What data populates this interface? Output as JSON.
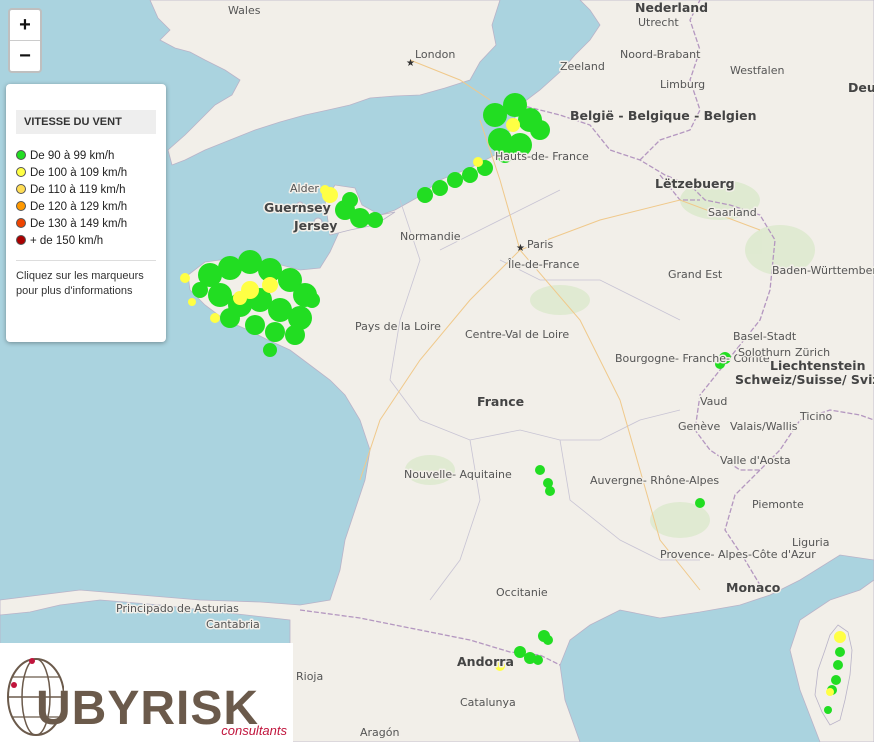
{
  "zoom": {
    "in_label": "+",
    "out_label": "−"
  },
  "legend": {
    "title": "VITESSE DU VENT",
    "items": [
      {
        "label": "De 90 à 99 km/h",
        "color": "#22dd22"
      },
      {
        "label": "De 100 à 109 km/h",
        "color": "#ffff44"
      },
      {
        "label": "De 110 à 119 km/h",
        "color": "#ffdd55"
      },
      {
        "label": "De 120 à 129 km/h",
        "color": "#ff9900"
      },
      {
        "label": "De 130 à 149 km/h",
        "color": "#ee4400"
      },
      {
        "label": "+ de 150 km/h",
        "color": "#aa0000"
      }
    ],
    "hint": "Cliquez sur les marqueurs pour plus d'informations"
  },
  "logo": {
    "brand": "UBYRISK",
    "sub": "consultants",
    "brand_color": "#6b5a4b",
    "accent_color": "#c0143c"
  },
  "map_labels": {
    "countries": {
      "nederland": "Nederland",
      "belgium": "België - Belgique - Belgien",
      "luxembourg": "Lëtzebuerg",
      "france": "France",
      "switzerland": "Schweiz/Suisse/ Svizzera/Svizra",
      "liechtenstein": "Liechtenstein",
      "monaco": "Monaco",
      "andorra": "Andorra",
      "deu": "Deu",
      "guernsey": "Guernsey",
      "jersey": "Jersey"
    },
    "cities": {
      "london": "London",
      "paris": "Paris",
      "wales": "Wales",
      "utrecht": "Utrecht",
      "zeeland": "Zeeland",
      "noord_brabant": "Noord-Brabant",
      "limburg": "Limburg",
      "westfalen": "Westfalen",
      "hauts_de_france": "Hauts-de- France",
      "normandie": "Normandie",
      "ile_de_france": "Île-de-France",
      "grand_est": "Grand Est",
      "saarland": "Saarland",
      "baden": "Baden-Württemberg",
      "pays_de_la_loire": "Pays de la Loire",
      "centre": "Centre-Val de Loire",
      "bourgogne": "Bourgogne- Franche- Comté",
      "nouvelle_aquitaine": "Nouvelle- Aquitaine",
      "auvergne": "Auvergne- Rhône-Alpes",
      "occitanie": "Occitanie",
      "provence": "Provence- Alpes-Côte d'Azur",
      "piemonte": "Piemonte",
      "liguria": "Liguria",
      "valle_aosta": "Valle d'Aosta",
      "valais": "Valais/Wallis",
      "ticino": "Ticino",
      "geneve": "Genève",
      "vaud": "Vaud",
      "solothurn": "Solothurn",
      "basel": "Basel-Stadt",
      "zurich": "Zürich",
      "asturias": "Principado de Asturias",
      "cantabria": "Cantabria",
      "rioja": "Rioja",
      "catalunya": "Catalunya",
      "aragon": "Aragón",
      "alder": "Alder"
    }
  }
}
